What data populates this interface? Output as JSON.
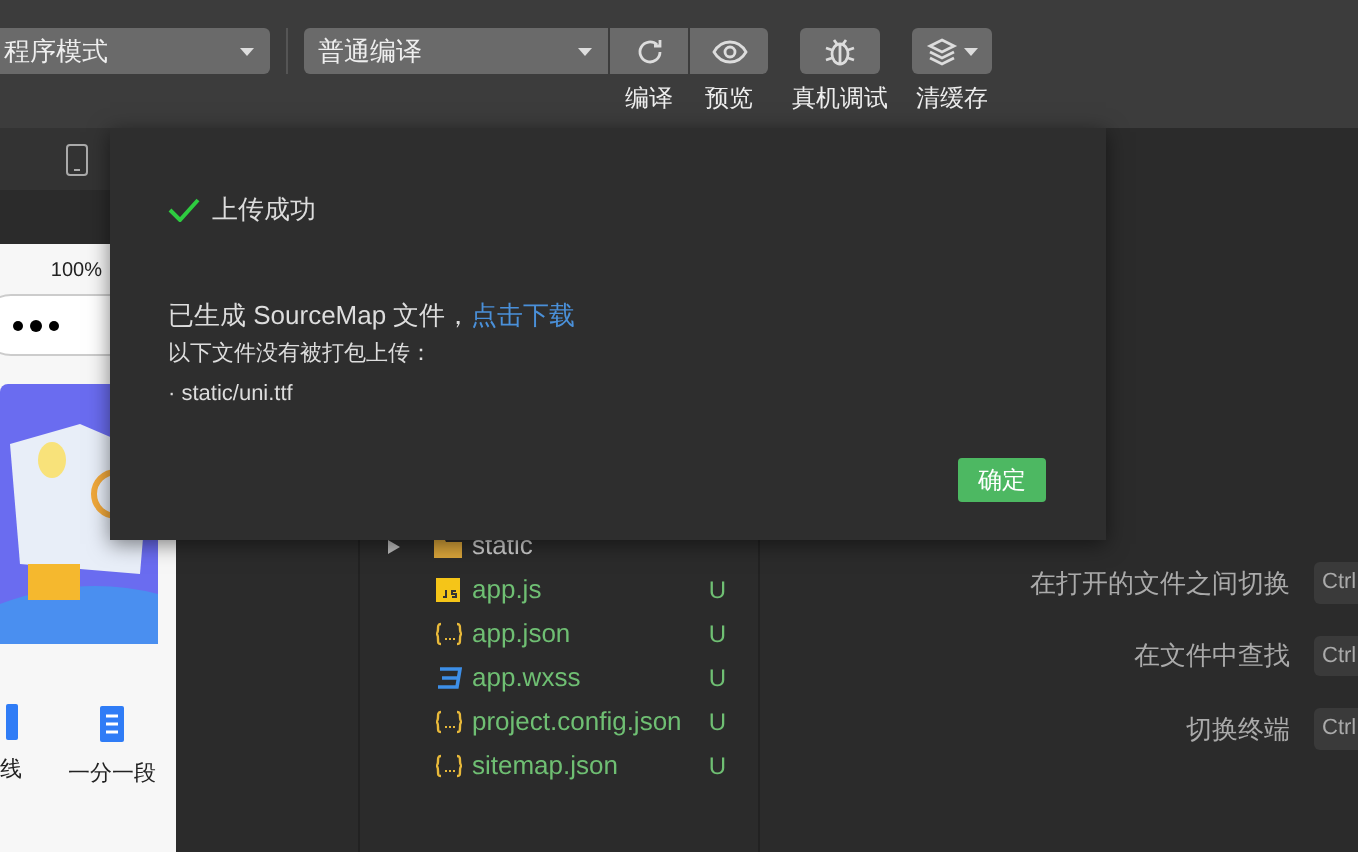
{
  "toolbar": {
    "mode_dropdown": "程序模式",
    "compile_dropdown": "普通编译",
    "buttons": [
      {
        "label": "编译",
        "kind": "refresh"
      },
      {
        "label": "预览",
        "kind": "eye"
      },
      {
        "label": "真机调试",
        "kind": "bug"
      },
      {
        "label": "清缓存",
        "kind": "layers"
      }
    ]
  },
  "simulator": {
    "battery": "100%",
    "shortcuts": [
      {
        "label": "线",
        "kind": "doc"
      },
      {
        "label": "一分一段",
        "kind": "scroll"
      }
    ]
  },
  "file_tree": [
    {
      "name": "static",
      "kind": "folder",
      "expanded": false
    },
    {
      "name": "app.js",
      "kind": "js",
      "status": "U"
    },
    {
      "name": "app.json",
      "kind": "json",
      "status": "U"
    },
    {
      "name": "app.wxss",
      "kind": "css",
      "status": "U"
    },
    {
      "name": "project.config.json",
      "kind": "json",
      "status": "U"
    },
    {
      "name": "sitemap.json",
      "kind": "json",
      "status": "U"
    }
  ],
  "shortcuts": [
    {
      "label": "在打开的文件之间切换",
      "key": "Ctrl"
    },
    {
      "label": "在文件中查找",
      "key": "Ctrl"
    },
    {
      "label": "切换终端",
      "key": "Ctrl"
    }
  ],
  "dialog": {
    "title": "上传成功",
    "message": "已生成 SourceMap 文件，",
    "link": "点击下载",
    "note": "以下文件没有被打包上传：",
    "files": [
      "· static/uni.ttf"
    ],
    "button": "确定"
  }
}
